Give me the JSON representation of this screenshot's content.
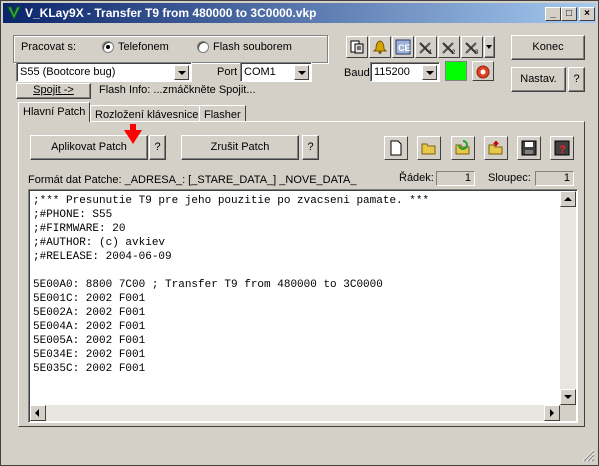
{
  "window": {
    "title": "V_KLay9X - Transfer T9 from 480000 to 3C0000.vkp",
    "minimize_label": "_",
    "maximize_label": "□",
    "close_label": "×"
  },
  "connection": {
    "work_with_label": "Pracovat s:",
    "radio_phone_label": "Telefonem",
    "radio_flash_label": "Flash souborem",
    "selected": "Telefonem",
    "phone_model_value": "S55 (Bootcore bug)",
    "port_label": "Port",
    "port_value": "COM1",
    "baud_label": "Baud",
    "baud_value": "115200",
    "status_color": "#00ff00",
    "connect_button": "Spojit ->",
    "flash_info": "Flash Info: ...zmáčkněte Spojit..."
  },
  "right_buttons": {
    "end_label": "Konec",
    "settings_label": "Nastav.",
    "help_label": "?"
  },
  "toolbar_icons": [
    "phone-book-icon",
    "bell-icon",
    "ce-icon",
    "tools-1-icon",
    "tools-2-icon",
    "tools-3-icon",
    "dropdown-arrow-icon"
  ],
  "tabs": [
    {
      "label": "Hlavní Patch",
      "active": true
    },
    {
      "label": "Rozložení klávesnice",
      "active": false
    },
    {
      "label": "Flasher",
      "active": false
    }
  ],
  "patch": {
    "apply_label": "Aplikovat Patch",
    "apply_help": "?",
    "cancel_label": "Zrušit Patch",
    "cancel_help": "?",
    "format_label": "Formát dat Patche: _ADRESA_: [_STARE_DATA_] _NOVE_DATA_",
    "row_label": "Řádek:",
    "row_value": "1",
    "col_label": "Sloupec:",
    "col_value": "1",
    "file_icons": [
      "new-file-icon",
      "open-folder-icon",
      "reload-icon",
      "add-folder-icon",
      "save-icon",
      "delete-icon"
    ],
    "arrow_color": "#ff0000"
  },
  "editor": {
    "lines": [
      ";*** Presunutie T9 pre jeho pouzitie po zvacseni pamate. ***",
      ";#PHONE: S55",
      ";#FIRMWARE: 20",
      ";#AUTHOR: (c) avkiev",
      ";#RELEASE: 2004-06-09",
      "",
      "5E00A0: 8800 7C00 ; Transfer T9 from 480000 to 3C0000",
      "5E001C: 2002 F001",
      "5E002A: 2002 F001",
      "5E004A: 2002 F001",
      "5E005A: 2002 F001",
      "5E034E: 2002 F001",
      "5E035C: 2002 F001"
    ]
  }
}
